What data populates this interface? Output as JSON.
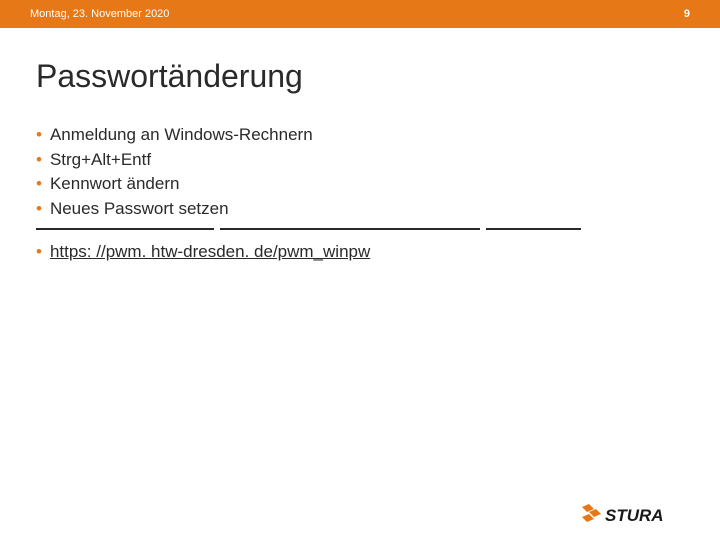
{
  "header": {
    "date": "Montag, 23. November 2020",
    "page": "9"
  },
  "title": "Passwortänderung",
  "bullets": [
    "Anmeldung an Windows-Rechnern",
    "Strg+Alt+Entf",
    "Kennwort ändern",
    "Neues Passwort setzen"
  ],
  "link": {
    "text": "https: //pwm. htw-dresden. de/pwm_winpw"
  },
  "footer": {
    "logo_text": "STURA"
  },
  "colors": {
    "accent": "#e77817"
  }
}
